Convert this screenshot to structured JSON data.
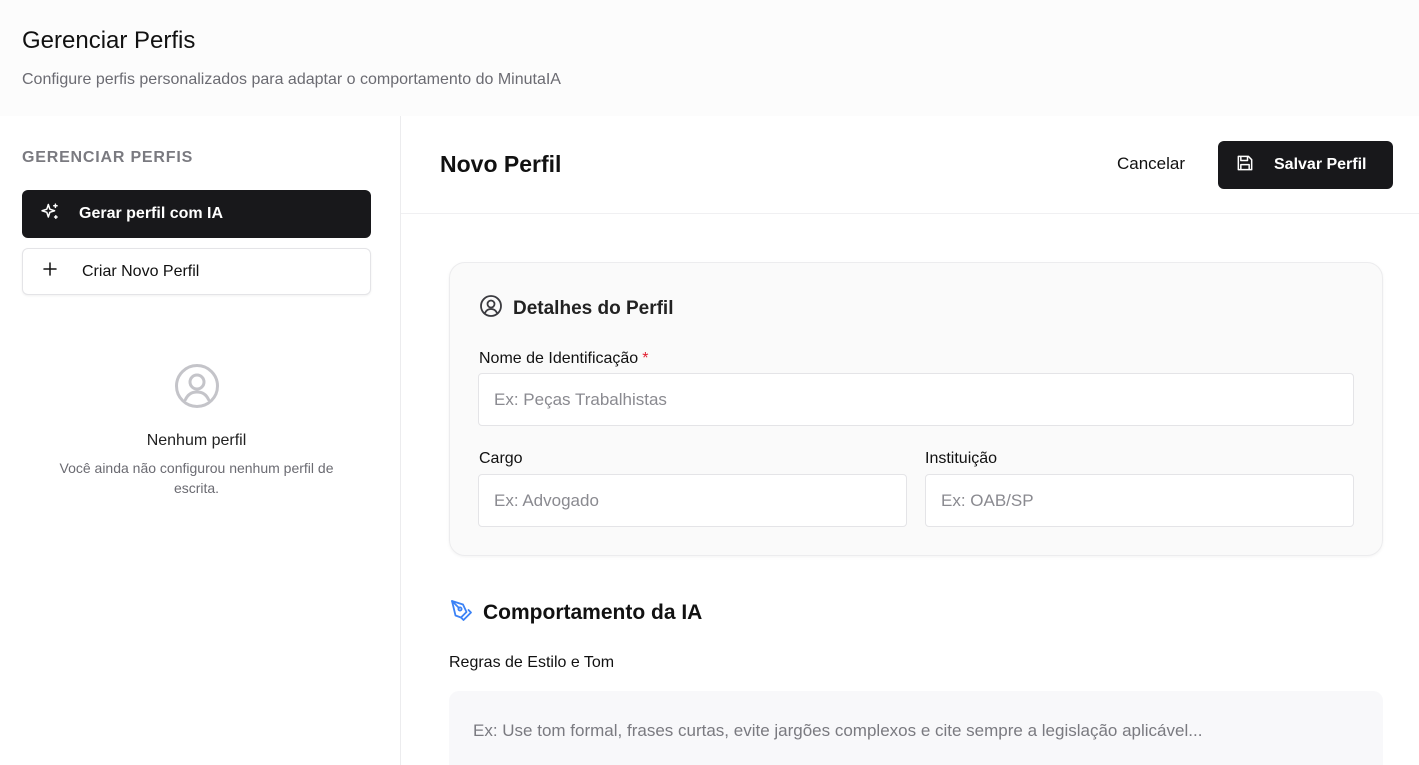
{
  "header": {
    "title": "Gerenciar Perfis",
    "subtitle": "Configure perfis personalizados para adaptar o comportamento do MinutaIA"
  },
  "sidebar": {
    "heading": "GERENCIAR PERFIS",
    "generate_button": {
      "label": "Gerar perfil com IA",
      "icon": "sparkles-icon"
    },
    "create_button": {
      "label": "Criar Novo Perfil",
      "icon": "plus-icon"
    },
    "empty_state": {
      "icon": "user-circle-icon",
      "title": "Nenhum perfil",
      "description": "Você ainda não configurou nenhum perfil de escrita."
    }
  },
  "main": {
    "title": "Novo Perfil",
    "cancel_label": "Cancelar",
    "save_label": "Salvar Perfil",
    "save_icon": "save-icon",
    "details": {
      "title": "Detalhes do Perfil",
      "icon": "user-circle-icon",
      "name_label": "Nome de Identificação",
      "name_required": "*",
      "name_placeholder": "Ex: Peças Trabalhistas",
      "name_value": "",
      "cargo_label": "Cargo",
      "cargo_placeholder": "Ex: Advogado",
      "cargo_value": "",
      "instituicao_label": "Instituição",
      "instituicao_placeholder": "Ex: OAB/SP",
      "instituicao_value": ""
    },
    "behavior": {
      "title": "Comportamento da IA",
      "icon": "pen-tool-icon",
      "rules_label": "Regras de Estilo e Tom",
      "rules_placeholder": "Ex: Use tom formal, frases curtas, evite jargões complexos e cite sempre a legislação aplicável...",
      "rules_value": ""
    }
  },
  "colors": {
    "primary_button": "#18181b",
    "accent_icon": "#3b82f6",
    "required_mark": "#e11d2e",
    "muted_text": "#6b6b72"
  }
}
